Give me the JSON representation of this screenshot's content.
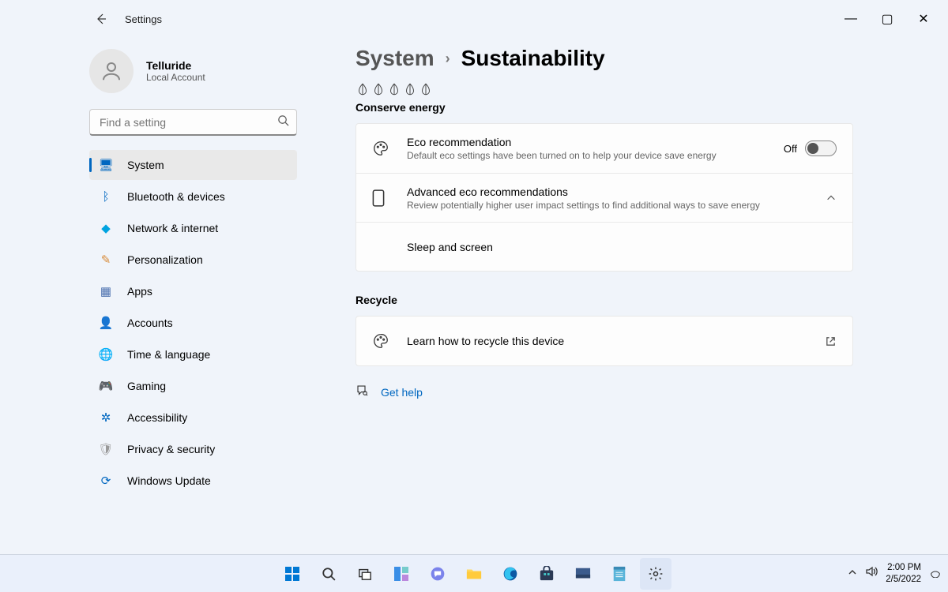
{
  "window": {
    "title": "Settings"
  },
  "winctl": {
    "min": "—",
    "max": "▢",
    "close": "✕"
  },
  "user": {
    "name": "Telluride",
    "sub": "Local Account"
  },
  "search": {
    "placeholder": "Find a setting"
  },
  "nav": [
    {
      "label": "System",
      "icon": "🖥",
      "color": "#0067c0",
      "selected": true
    },
    {
      "label": "Bluetooth & devices",
      "icon": "ᛒ",
      "color": "#0067c0"
    },
    {
      "label": "Network & internet",
      "icon": "◆",
      "color": "#00a3e0"
    },
    {
      "label": "Personalization",
      "icon": "✎",
      "color": "#d88b3a"
    },
    {
      "label": "Apps",
      "icon": "▦",
      "color": "#4a6fae"
    },
    {
      "label": "Accounts",
      "icon": "👤",
      "color": "#2aa876"
    },
    {
      "label": "Time & language",
      "icon": "🌐",
      "color": "#2a8"
    },
    {
      "label": "Gaming",
      "icon": "🎮",
      "color": "#888"
    },
    {
      "label": "Accessibility",
      "icon": "✲",
      "color": "#0067c0"
    },
    {
      "label": "Privacy & security",
      "icon": "🛡",
      "color": "#999"
    },
    {
      "label": "Windows Update",
      "icon": "⟳",
      "color": "#0067c0"
    }
  ],
  "breadcrumb": {
    "parent": "System",
    "current": "Sustainability"
  },
  "sections": {
    "conserve": {
      "title": "Conserve energy",
      "eco": {
        "title": "Eco recommendation",
        "desc": "Default eco settings have been turned on to help your device save energy",
        "state_label": "Off"
      },
      "adv": {
        "title": "Advanced eco recommendations",
        "desc": "Review potentially higher user impact settings to find additional ways to save energy"
      },
      "sleep": {
        "title": "Sleep and screen"
      }
    },
    "recycle": {
      "title": "Recycle",
      "row": {
        "title": "Learn how to recycle this device"
      }
    }
  },
  "help": {
    "label": "Get help"
  },
  "taskbar": {
    "time": "2:00 PM",
    "date": "2/5/2022"
  }
}
